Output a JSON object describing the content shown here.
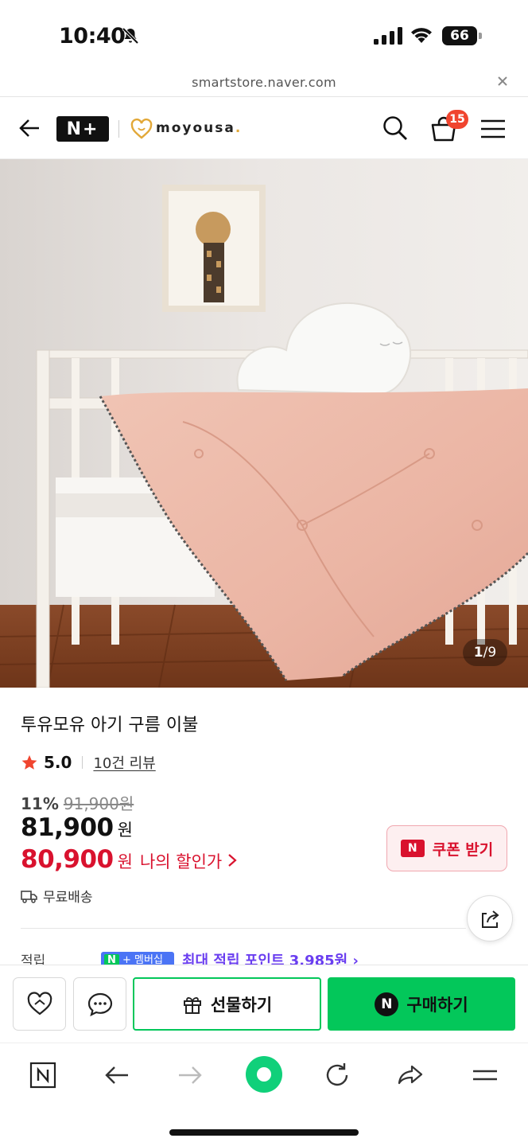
{
  "status_bar": {
    "time": "10:40",
    "battery": "66",
    "icons": [
      "bell-slash-icon",
      "signal-icon",
      "wifi-icon",
      "battery-icon"
    ]
  },
  "url_bar": {
    "url": "smartstore.naver.com",
    "close_icon": "close-icon"
  },
  "header": {
    "back_icon": "arrow-left-icon",
    "nplus_label": "N+",
    "brand_name": "moyousa",
    "brand_dot": ".",
    "search_icon": "search-icon",
    "cart_icon": "cart-icon",
    "cart_count": "15",
    "menu_icon": "hamburger-icon"
  },
  "hero": {
    "image_current": "1",
    "image_total": "/9"
  },
  "product": {
    "title": "투유모유 아기 구름 이불",
    "rating": "5.0",
    "reviews": "10건 리뷰",
    "discount_rate": "11%",
    "original_price": "91,900원",
    "price": "81,900",
    "price_unit": "원",
    "my_price": "80,900",
    "my_price_unit": "원",
    "my_price_label": "나의 할인가",
    "coupon_icon_label": "N",
    "coupon_label": "쿠폰 받기",
    "shipping": "무료배송",
    "points_label": "적립",
    "points_badge_n": "N",
    "points_badge_text": "+ 멤버십",
    "points_text": "최대 적립 포인트 3,985원 ›"
  },
  "action_bar": {
    "wish_icon": "heart-icon",
    "talk_icon": "chat-icon",
    "gift_label": "선물하기",
    "gift_icon": "gift-icon",
    "buy_icon_label": "N",
    "buy_label": "구매하기"
  },
  "toolbar": {
    "items": [
      "naver-home-icon",
      "back-icon",
      "forward-icon",
      "green-dot-icon",
      "reload-icon",
      "share-icon",
      "menu-icon"
    ]
  },
  "colors": {
    "accent_green": "#03c75a",
    "price_red": "#d9122e",
    "badge_red": "#f0452f",
    "points_purple": "#6a3ef0"
  }
}
